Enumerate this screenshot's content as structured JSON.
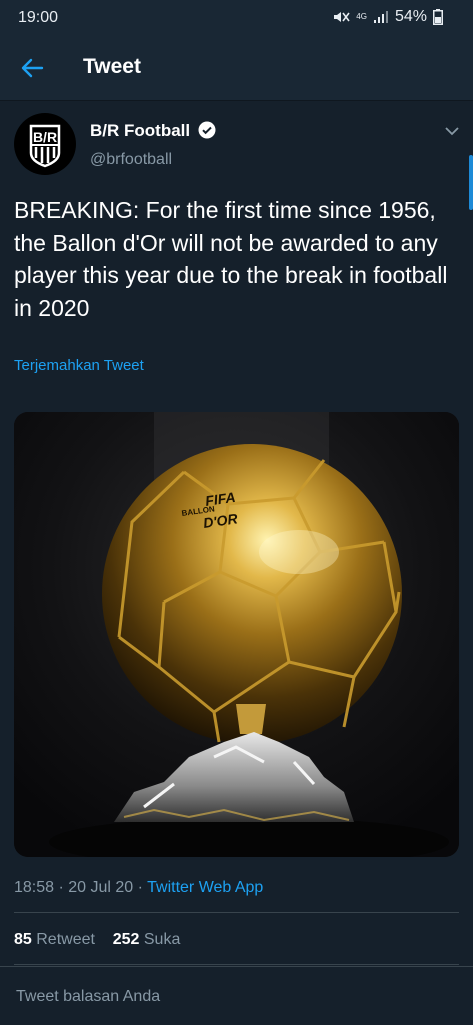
{
  "status": {
    "time": "19:00",
    "network": "4G",
    "battery": "54%",
    "colors": {
      "bar": "#192734",
      "text": "#e8edf2"
    }
  },
  "header": {
    "title": "Tweet",
    "back_icon": "arrow-left-icon"
  },
  "tweet": {
    "author": {
      "name": "B/R Football",
      "handle": "@brfootball",
      "verified": true,
      "avatar_text": "B/R"
    },
    "text": "BREAKING: For the first time since 1956, the Ballon d'Or will not be awarded to any player this year due to the break in football in 2020",
    "translate_label": "Terjemahkan Tweet",
    "media": {
      "logo_line1": "FIFA",
      "logo_line2": "BALLON",
      "logo_line3": "D'OR"
    },
    "timestamp": "18:58 · 20 Jul 20 · ",
    "source": "Twitter Web App",
    "stats": {
      "retweets": "85",
      "retweets_label": " Retweet",
      "likes": "252",
      "likes_label": " Suka"
    }
  },
  "reply": {
    "placeholder": "Tweet balasan Anda"
  },
  "colors": {
    "background": "#15202b",
    "accent": "#1da1f2",
    "muted": "#8899a6",
    "divider": "#38444d"
  }
}
